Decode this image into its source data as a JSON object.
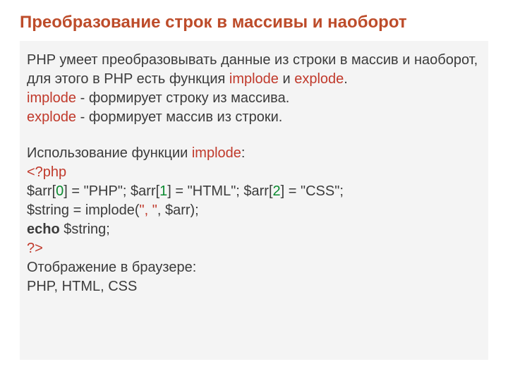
{
  "title": "Преобразование строк в массивы и наоборот",
  "intro": {
    "p1a": "PHP умеет преобразовывать данные из строки в массив и наоборот, для этого в PHP есть функция ",
    "implode": "implode",
    "p1b": " и ",
    "explode": "explode",
    "p1c": ".",
    "p2a": "implode",
    "p2b": " - формирует строку из массива.",
    "p3a": "explode",
    "p3b": " - формирует массив из строки."
  },
  "usage_label_a": "Использование функции ",
  "usage_label_b": "implode",
  "usage_label_c": ":",
  "code": {
    "open": "<?php",
    "l1a": "$arr[",
    "i0": "0",
    "l1b": "] = \"PHP\"; $arr[",
    "i1": "1",
    "l1c": "] = \"HTML\"; $arr[",
    "i2": "2",
    "l1d": "] = \"CSS\";",
    "l2a": "$string = implode(",
    "l2sep": "\", \"",
    "l2b": ", $arr);",
    "l3a": "echo",
    "l3b": " $string;",
    "close": "?>"
  },
  "output_label": "Отображение в браузере:",
  "output_value": "PHP,  HTML,  CSS"
}
